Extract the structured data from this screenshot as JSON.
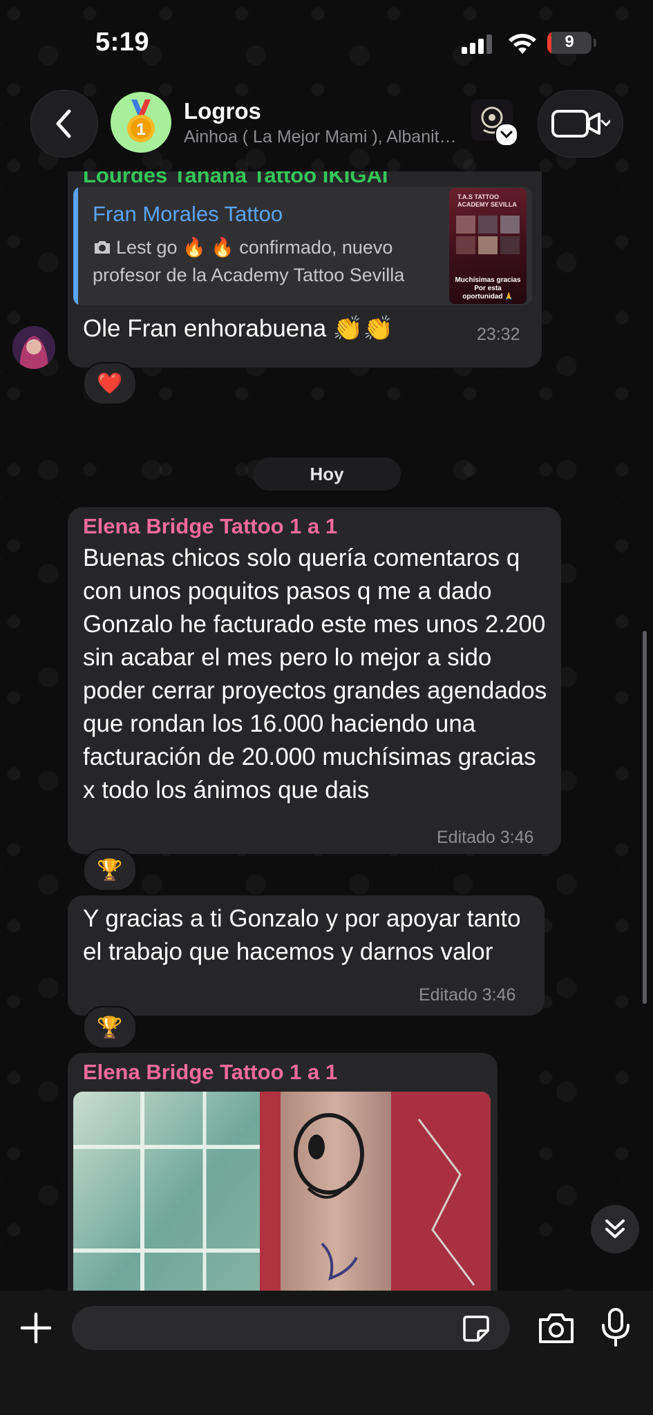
{
  "status_bar": {
    "time": "5:19",
    "battery_level": "9",
    "battery_fraction": 0.09
  },
  "header": {
    "title": "Logros",
    "subtitle": "Ainhoa ( La Mejor Mami ), Albanito, Alberto, Alejandra, Alex",
    "avatar_icon": "medal-icon",
    "avatar_bg": "#a7ef9a"
  },
  "messages": {
    "prev_sender": "Lourdes Tanana Tattoo IKIGAI",
    "prev_sender_color": "#34c759",
    "quote": {
      "name": "Fran Morales Tattoo",
      "text": "Lest go 🔥 🔥 confirmado, nuevo profesor de la Academy Tattoo Sevilla",
      "thumb_caption_top": "T.A.S TATTOO ACADEMY SEVILLA",
      "thumb_caption_bottom": "Muchísimas gracias Por esta oportunidad 🙏"
    },
    "reply_text": "Ole Fran enhorabuena 👏👏",
    "reply_time": "23:32",
    "reply_reaction": "❤️",
    "date_separator": "Hoy",
    "elena_sender": "Elena Bridge Tattoo 1 a 1",
    "elena_sender_color": "#f36b9a",
    "elena_text": "Buenas chicos solo quería comentaros q con unos poquitos pasos q me a dado Gonzalo he facturado este mes unos 2.200 sin acabar el mes pero lo mejor a sido poder cerrar proyectos grandes agendados que rondan los 16.000 haciendo una facturación de 20.000 muchísimas gracias x todo los ánimos que dais",
    "elena_meta": "Editado 3:46",
    "elena_reaction": "🏆",
    "thanks_text": "Y gracias a ti Gonzalo y por apoyar tanto el trabajo que hacemos y darnos valor",
    "thanks_meta": "Editado 3:46",
    "thanks_reaction": "🏆",
    "photo_sender": "Elena Bridge Tattoo 1 a 1"
  },
  "input": {
    "placeholder": "",
    "icons": [
      "plus-icon",
      "sticker-icon",
      "camera-icon",
      "microphone-icon"
    ]
  },
  "colors": {
    "bubble": "#262628",
    "quote_accent": "#5aa4f4",
    "meta": "#8e8e93"
  }
}
